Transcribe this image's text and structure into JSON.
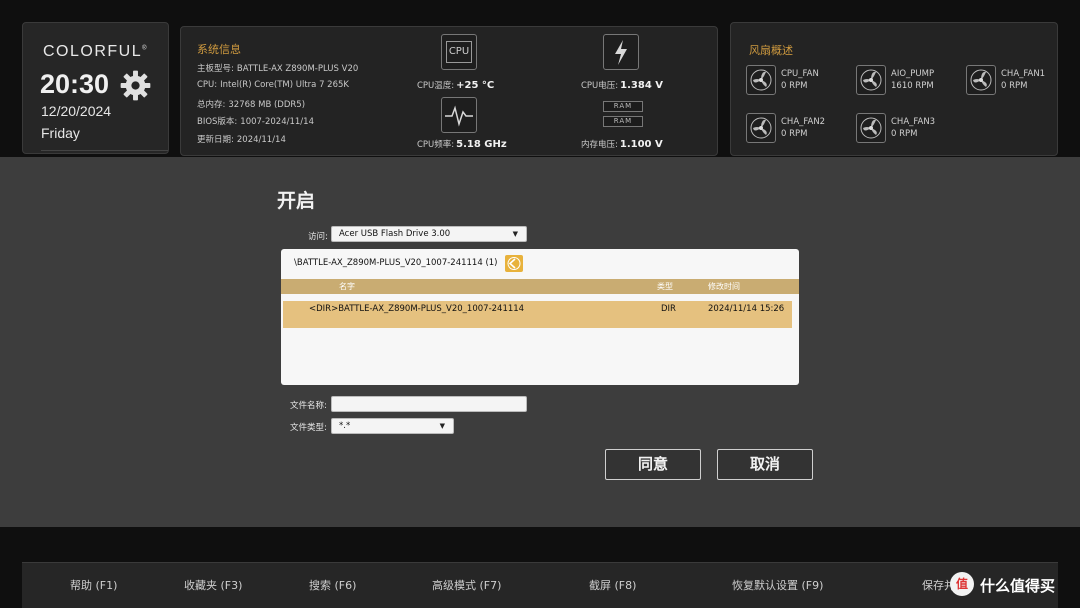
{
  "brand": {
    "logo": "COLORFUL",
    "logo_mark": "®",
    "time": "20:30",
    "date": "12/20/2024",
    "day": "Friday"
  },
  "system_info": {
    "title": "系统信息",
    "rows": [
      {
        "label": "主板型号:",
        "value": "BATTLE-AX Z890M-PLUS V20"
      },
      {
        "label": "CPU:",
        "value": "Intel(R) Core(TM) Ultra 7 265K"
      },
      {
        "label": "总内存:",
        "value": "32768 MB (DDR5)"
      },
      {
        "label": "BIOS版本:",
        "value": "1007-2024/11/14"
      },
      {
        "label": "更新日期:",
        "value": "2024/11/14"
      }
    ],
    "cpu_icon_text": "CPU",
    "cpu_temp_label": "CPU温度:",
    "cpu_temp_value": "+25 °C",
    "cpu_voltage_label": "CPU电压:",
    "cpu_voltage_value": "1.384 V",
    "cpu_freq_label": "CPU频率:",
    "cpu_freq_value": "5.18 GHz",
    "mem_voltage_label": "内存电压:",
    "mem_voltage_value": "1.100 V",
    "ram_chip_text": "RAM"
  },
  "fans": {
    "title": "风扇概述",
    "items": [
      {
        "name": "CPU_FAN",
        "rpm": "0 RPM"
      },
      {
        "name": "AIO_PUMP",
        "rpm": "1610 RPM"
      },
      {
        "name": "CHA_FAN1",
        "rpm": "0 RPM"
      },
      {
        "name": "CHA_FAN2",
        "rpm": "0 RPM"
      },
      {
        "name": "CHA_FAN3",
        "rpm": "0 RPM"
      }
    ]
  },
  "dialog": {
    "title": "开启",
    "access_label": "访问:",
    "access_value": "Acer USB Flash Drive 3.00",
    "current_path": "\\BATTLE-AX_Z890M-PLUS_V20_1007-241114 (1)",
    "columns": {
      "name": "名字",
      "type": "类型",
      "modified": "修改时间"
    },
    "rows": [
      {
        "name": "<DIR>BATTLE-AX_Z890M-PLUS_V20_1007-241114",
        "type": "DIR",
        "modified": "2024/11/14 15:26"
      }
    ],
    "filename_label": "文件名称:",
    "filename_value": "",
    "filetype_label": "文件类型:",
    "filetype_value": "*.*",
    "ok_label": "同意",
    "cancel_label": "取消"
  },
  "bottom_bar": {
    "items": [
      "帮助 (F1)",
      "收藏夹 (F3)",
      "搜索 (F6)",
      "高级模式 (F7)",
      "截屏 (F8)",
      "恢复默认设置 (F9)",
      "保存并"
    ]
  },
  "watermark": {
    "text": "什么值得买",
    "logo_char": "值"
  },
  "colors": {
    "accent": "#cf9a3f",
    "table_header": "#c9ac72",
    "selected_row": "#e5c17f",
    "up_button": "#e8b23c"
  },
  "icons": [
    "gear-icon",
    "cpu-icon",
    "lightning-icon",
    "pulse-icon",
    "ram-icon",
    "fan-icon",
    "dropdown-arrow-icon",
    "folder-up-icon"
  ]
}
